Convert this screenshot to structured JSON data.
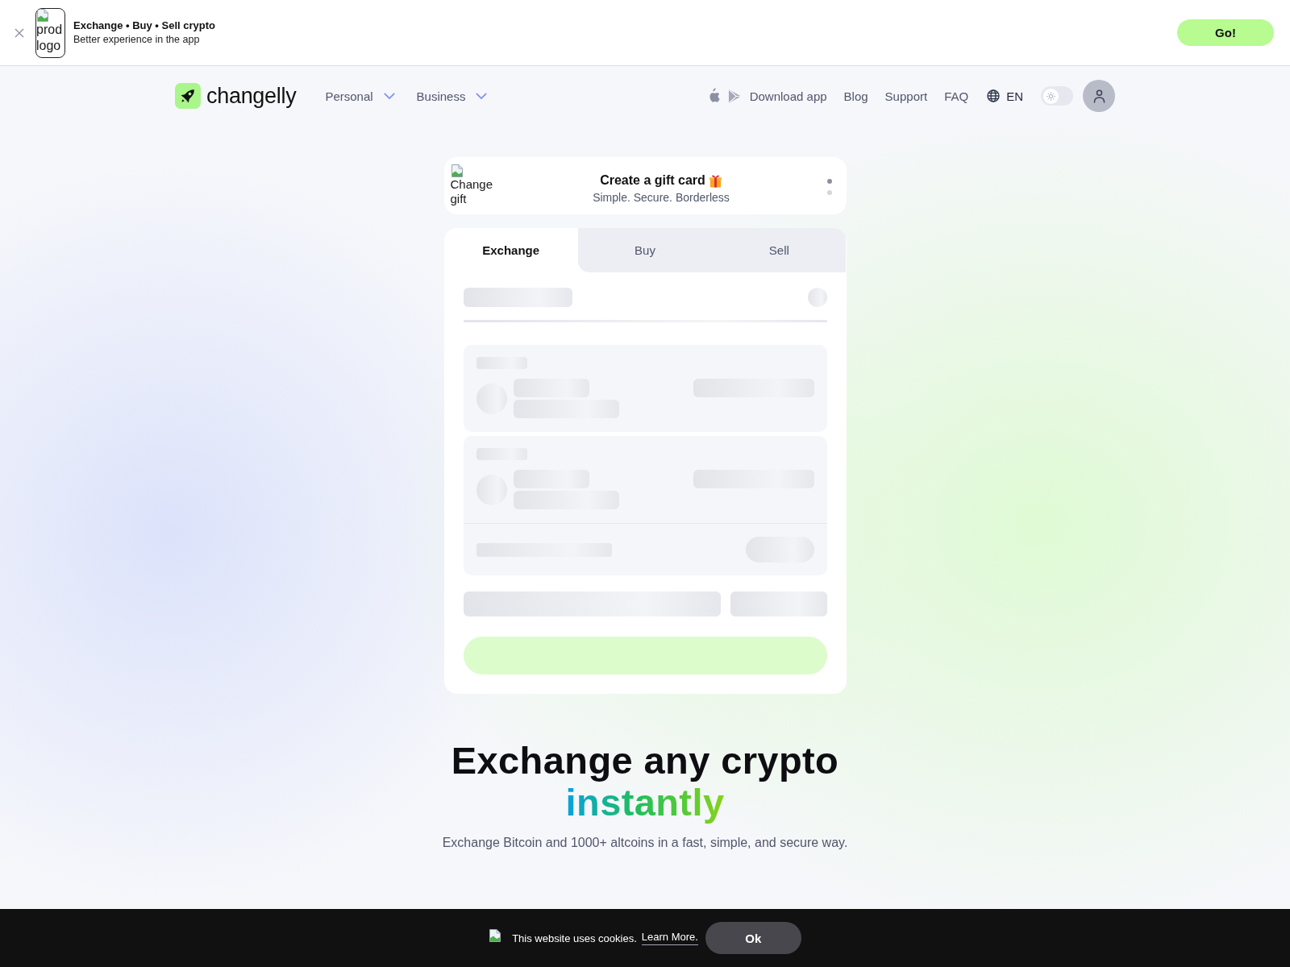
{
  "app_banner": {
    "logo_alt": "prod logo",
    "title": "Exchange • Buy • Sell crypto",
    "subtitle": "Better experience in the app",
    "button": "Go!"
  },
  "nav": {
    "brand": "changelly",
    "menus": [
      {
        "label": "Personal"
      },
      {
        "label": "Business"
      }
    ],
    "download": "Download app",
    "links": [
      "Blog",
      "Support",
      "FAQ"
    ],
    "language": "EN",
    "dark_mode": false
  },
  "promo": {
    "image_alt": "Change gift",
    "title": "Create a gift card",
    "subtitle": "Simple. Secure. Borderless",
    "slides": [
      {
        "selected": true
      },
      {
        "selected": false
      }
    ]
  },
  "widget": {
    "tabs": [
      {
        "label": "Exchange",
        "selected": true
      },
      {
        "label": "Buy",
        "selected": false
      },
      {
        "label": "Sell",
        "selected": false
      }
    ],
    "loading": true
  },
  "hero": {
    "title": "Exchange any crypto",
    "highlight": "instantly",
    "subtitle": "Exchange Bitcoin and 1000+ altcoins in a fast, simple, and secure way."
  },
  "cookie_banner": {
    "text": "This website uses cookies.",
    "link": "Learn More.",
    "button": "Ok"
  }
}
